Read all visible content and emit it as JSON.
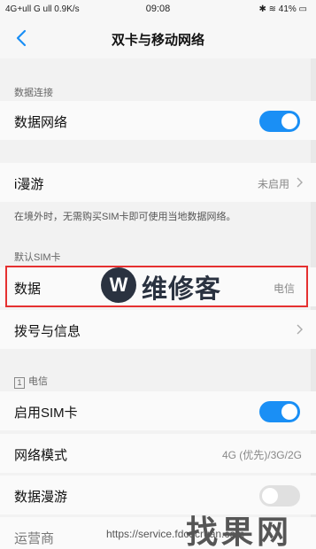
{
  "status": {
    "network": "4G+ull G ull 0.9K/s",
    "time": "09:08",
    "right": "✱ ≋ 41% ▭"
  },
  "header": {
    "title": "双卡与移动网络"
  },
  "data_connection": {
    "section": "数据连接",
    "network_label": "数据网络",
    "network_on": true
  },
  "roaming": {
    "label": "i漫游",
    "value": "未启用",
    "note": "在境外时，无需购买SIM卡即可使用当地数据网络。"
  },
  "default_sim": {
    "section": "默认SIM卡",
    "data_label": "数据",
    "data_value": "电信",
    "dial_label": "拨号与信息"
  },
  "sim1": {
    "badge": "1",
    "section": "电信",
    "enable_label": "启用SIM卡",
    "enable_on": true,
    "mode_label": "网络模式",
    "mode_value": "4G (优先)/3G/2G",
    "roam_label": "数据漫游",
    "roam_on": false,
    "carrier_label": "运营商"
  },
  "watermarks": {
    "logo_letter": "W",
    "brand": "维修客",
    "site": "找果网",
    "url": "https://service.fdcdcruan.com"
  },
  "colors": {
    "accent": "#1a8ff5",
    "highlight": "#e53030"
  }
}
